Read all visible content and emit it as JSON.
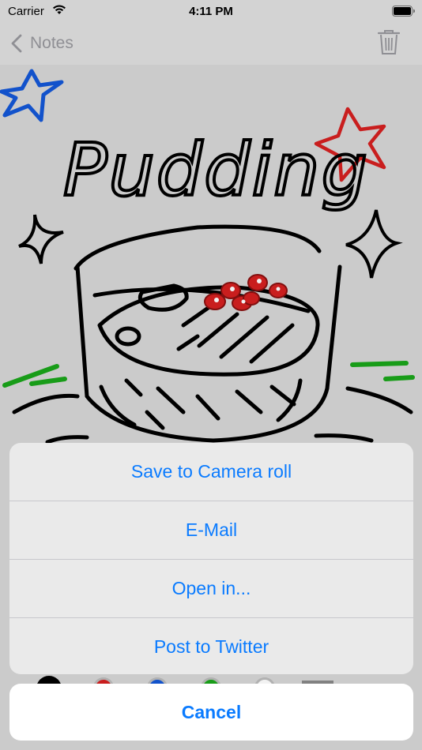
{
  "status_bar": {
    "carrier": "Carrier",
    "time": "4:11 PM"
  },
  "nav": {
    "back_label": "Notes",
    "back_icon": "chevron-left-icon",
    "trash_icon": "trash-icon"
  },
  "drawing": {
    "title_text": "Pudding",
    "ink_colors": {
      "black": "#000000",
      "blue": "#1457d6",
      "red": "#d42020",
      "green": "#1aa51a"
    }
  },
  "palette": {
    "colors": [
      "#000000",
      "#d42020",
      "#1457d6",
      "#1aa51a",
      "#ffffff",
      "#888888"
    ]
  },
  "action_sheet": {
    "items": [
      {
        "label": "Save to Camera roll"
      },
      {
        "label": "E-Mail"
      },
      {
        "label": "Open in..."
      },
      {
        "label": "Post to Twitter"
      }
    ],
    "cancel_label": "Cancel"
  },
  "colors": {
    "accent": "#0a7bff",
    "nav_gray": "#8f8f94"
  }
}
